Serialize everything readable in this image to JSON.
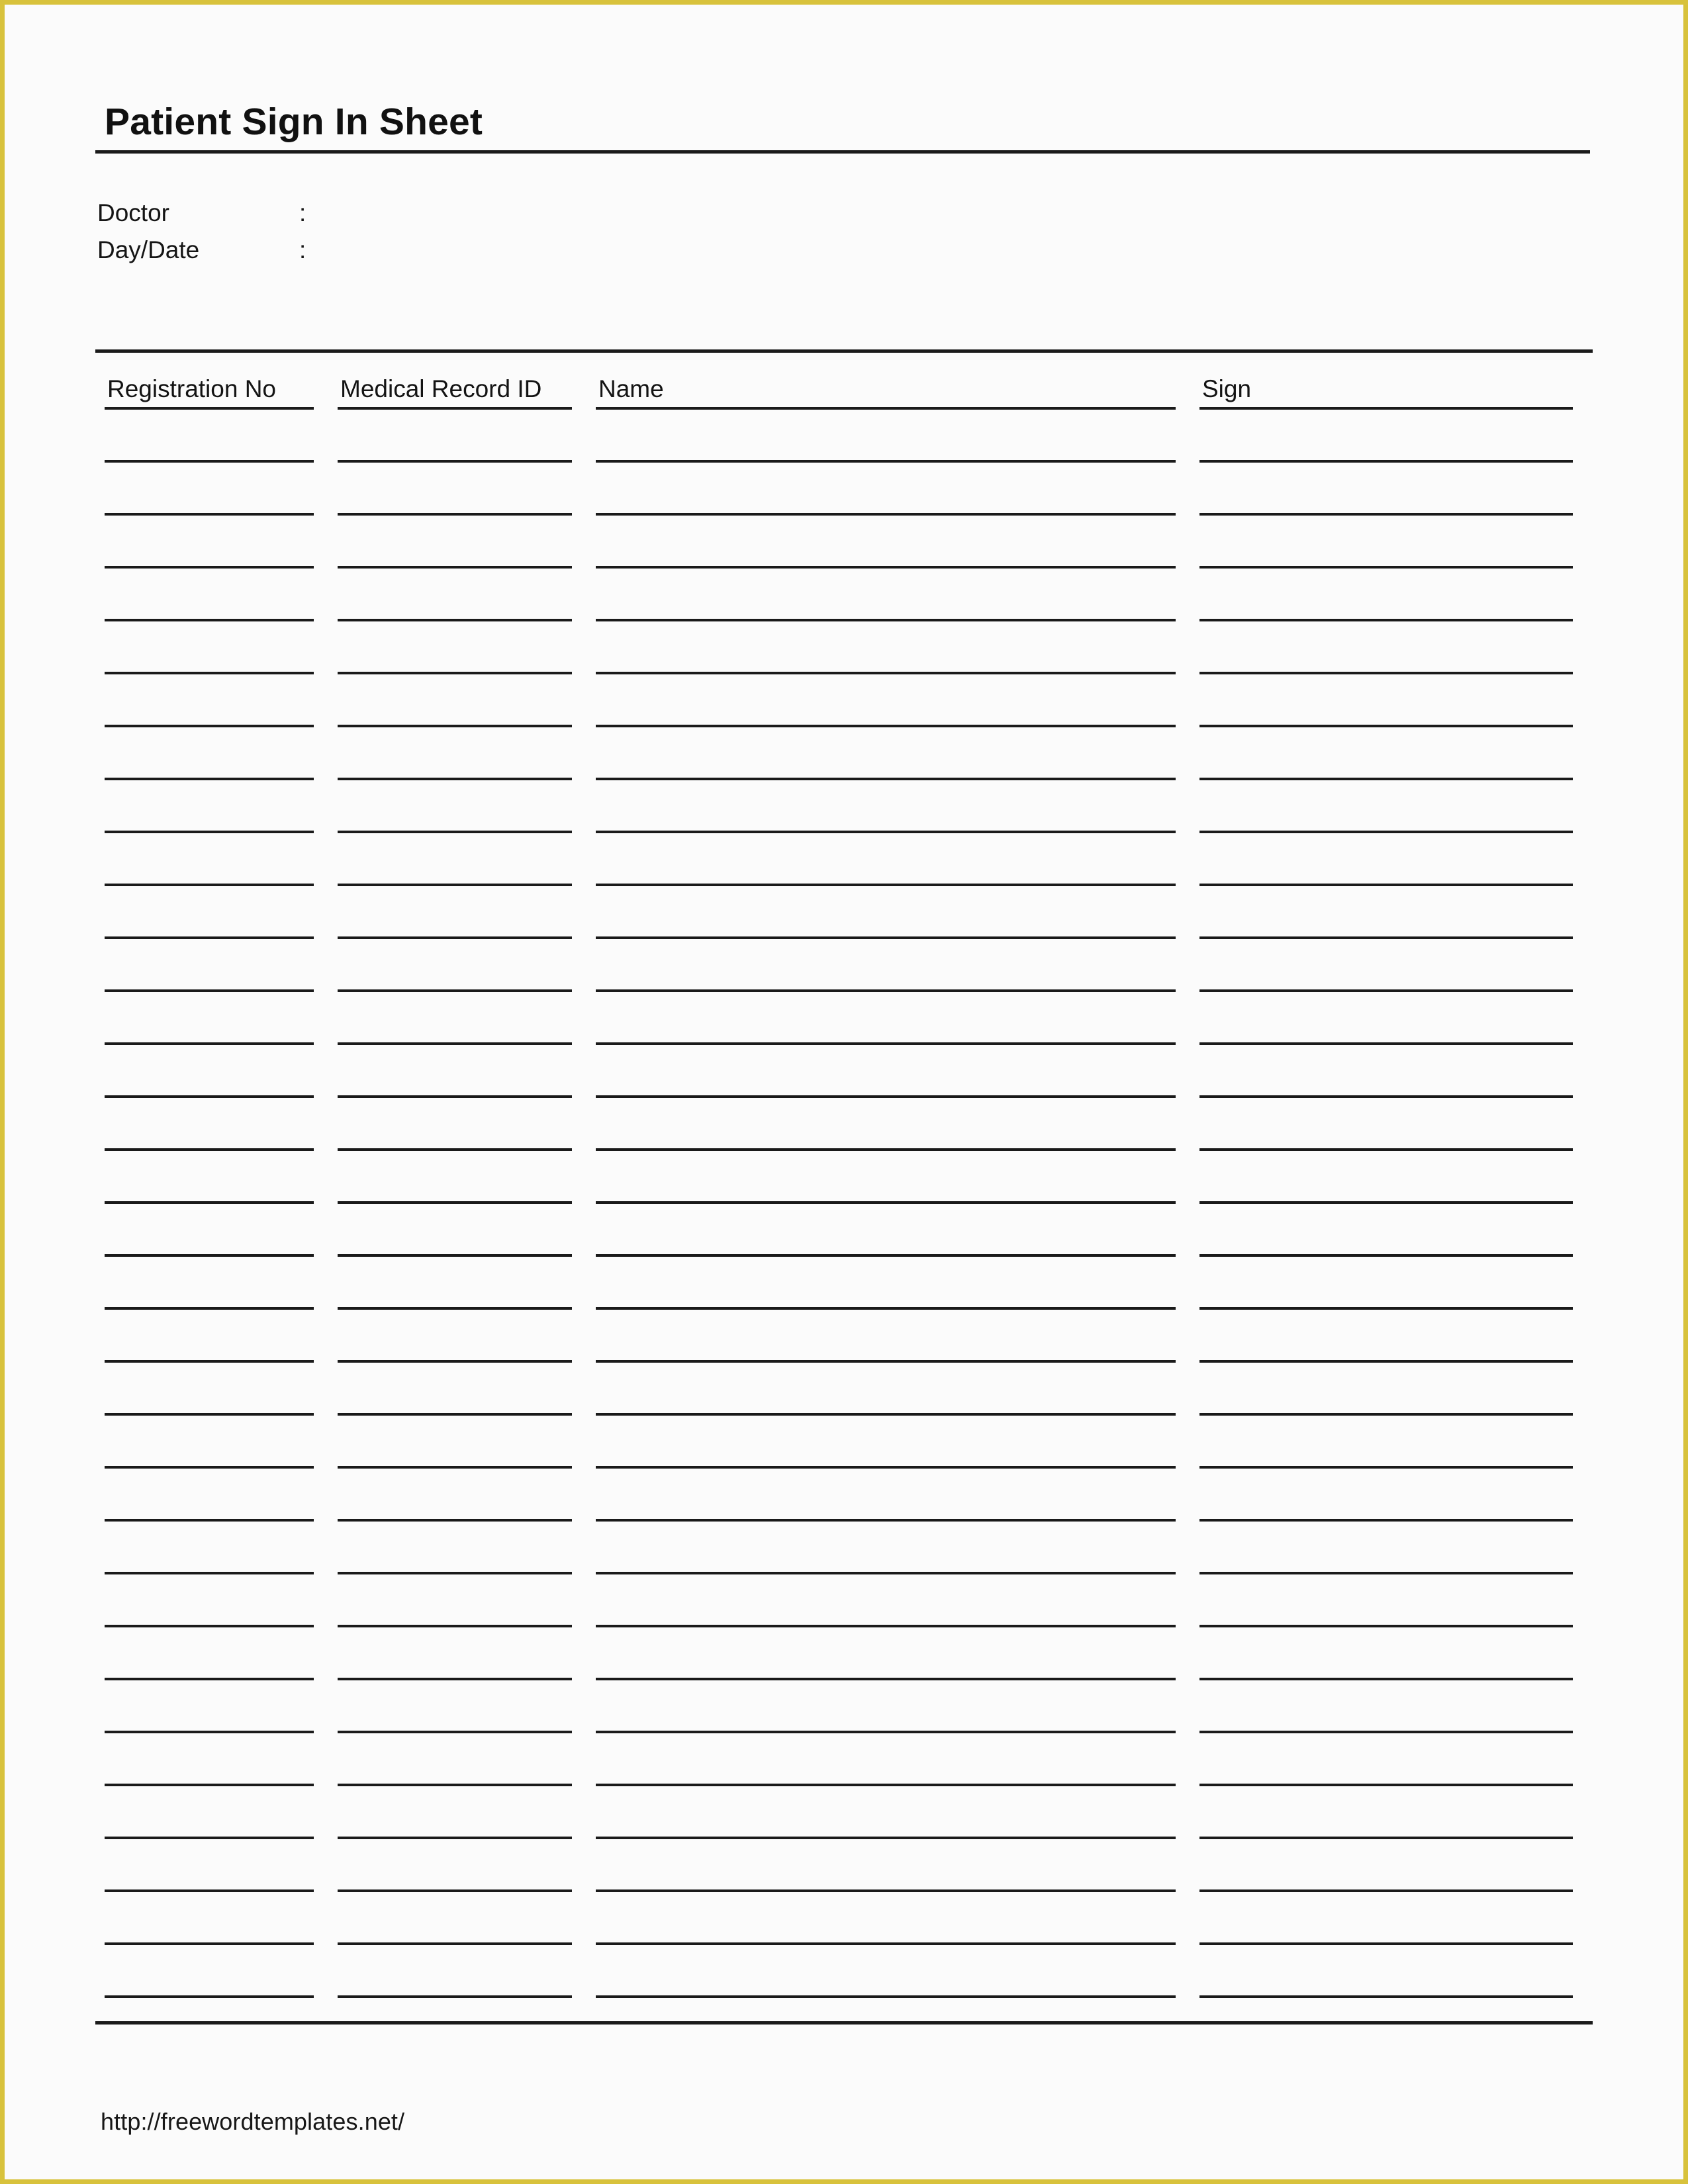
{
  "page": {
    "background_color": "#fbfbfb",
    "border_color": "#d8c23c",
    "text_color": "#141414",
    "rule_color": "#1a1a1a"
  },
  "document": {
    "title": "Patient Sign In Sheet"
  },
  "meta": {
    "rows": [
      {
        "label": "Doctor",
        "colon": ":",
        "value": ""
      },
      {
        "label": "Day/Date",
        "colon": ":",
        "value": ""
      }
    ]
  },
  "table": {
    "columns": [
      {
        "key": "registration_no",
        "label": "Registration No"
      },
      {
        "key": "medical_record_id",
        "label": "Medical Record ID"
      },
      {
        "key": "name",
        "label": "Name"
      },
      {
        "key": "sign",
        "label": "Sign"
      }
    ],
    "row_count": 30,
    "rows": [
      {
        "registration_no": "",
        "medical_record_id": "",
        "name": "",
        "sign": ""
      },
      {
        "registration_no": "",
        "medical_record_id": "",
        "name": "",
        "sign": ""
      },
      {
        "registration_no": "",
        "medical_record_id": "",
        "name": "",
        "sign": ""
      },
      {
        "registration_no": "",
        "medical_record_id": "",
        "name": "",
        "sign": ""
      },
      {
        "registration_no": "",
        "medical_record_id": "",
        "name": "",
        "sign": ""
      },
      {
        "registration_no": "",
        "medical_record_id": "",
        "name": "",
        "sign": ""
      },
      {
        "registration_no": "",
        "medical_record_id": "",
        "name": "",
        "sign": ""
      },
      {
        "registration_no": "",
        "medical_record_id": "",
        "name": "",
        "sign": ""
      },
      {
        "registration_no": "",
        "medical_record_id": "",
        "name": "",
        "sign": ""
      },
      {
        "registration_no": "",
        "medical_record_id": "",
        "name": "",
        "sign": ""
      },
      {
        "registration_no": "",
        "medical_record_id": "",
        "name": "",
        "sign": ""
      },
      {
        "registration_no": "",
        "medical_record_id": "",
        "name": "",
        "sign": ""
      },
      {
        "registration_no": "",
        "medical_record_id": "",
        "name": "",
        "sign": ""
      },
      {
        "registration_no": "",
        "medical_record_id": "",
        "name": "",
        "sign": ""
      },
      {
        "registration_no": "",
        "medical_record_id": "",
        "name": "",
        "sign": ""
      },
      {
        "registration_no": "",
        "medical_record_id": "",
        "name": "",
        "sign": ""
      },
      {
        "registration_no": "",
        "medical_record_id": "",
        "name": "",
        "sign": ""
      },
      {
        "registration_no": "",
        "medical_record_id": "",
        "name": "",
        "sign": ""
      },
      {
        "registration_no": "",
        "medical_record_id": "",
        "name": "",
        "sign": ""
      },
      {
        "registration_no": "",
        "medical_record_id": "",
        "name": "",
        "sign": ""
      },
      {
        "registration_no": "",
        "medical_record_id": "",
        "name": "",
        "sign": ""
      },
      {
        "registration_no": "",
        "medical_record_id": "",
        "name": "",
        "sign": ""
      },
      {
        "registration_no": "",
        "medical_record_id": "",
        "name": "",
        "sign": ""
      },
      {
        "registration_no": "",
        "medical_record_id": "",
        "name": "",
        "sign": ""
      },
      {
        "registration_no": "",
        "medical_record_id": "",
        "name": "",
        "sign": ""
      },
      {
        "registration_no": "",
        "medical_record_id": "",
        "name": "",
        "sign": ""
      },
      {
        "registration_no": "",
        "medical_record_id": "",
        "name": "",
        "sign": ""
      },
      {
        "registration_no": "",
        "medical_record_id": "",
        "name": "",
        "sign": ""
      },
      {
        "registration_no": "",
        "medical_record_id": "",
        "name": "",
        "sign": ""
      },
      {
        "registration_no": "",
        "medical_record_id": "",
        "name": "",
        "sign": ""
      }
    ]
  },
  "footer": {
    "url": "http://freewordtemplates.net/"
  }
}
